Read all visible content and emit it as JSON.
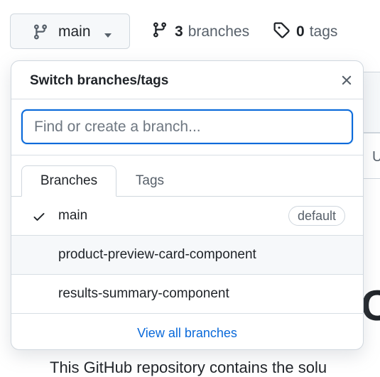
{
  "toolbar": {
    "branch_label": "main",
    "branches_count": "3",
    "branches_word": "branches",
    "tags_count": "0",
    "tags_word": "tags"
  },
  "background": {
    "col_label": "U",
    "heading_fragment": "C",
    "para_fragment": "This GitHub repository contains the solu"
  },
  "dropdown": {
    "title": "Switch branches/tags",
    "search_placeholder": "Find or create a branch...",
    "tabs": [
      {
        "label": "Branches",
        "active": true
      },
      {
        "label": "Tags",
        "active": false
      }
    ],
    "items": [
      {
        "label": "main",
        "selected": true,
        "badge": "default"
      },
      {
        "label": "product-preview-card-component",
        "selected": false,
        "badge": ""
      },
      {
        "label": "results-summary-component",
        "selected": false,
        "badge": ""
      }
    ],
    "footer_link": "View all branches"
  },
  "colors": {
    "accent": "#0969da",
    "border": "#d0d7de",
    "muted_text": "#57606a",
    "hover_bg": "#f6f8fa"
  },
  "icons": {
    "branch": "git-branch-icon",
    "tag": "tag-icon",
    "check": "check-icon",
    "close": "x-icon",
    "caret": "triangle-down-icon"
  }
}
